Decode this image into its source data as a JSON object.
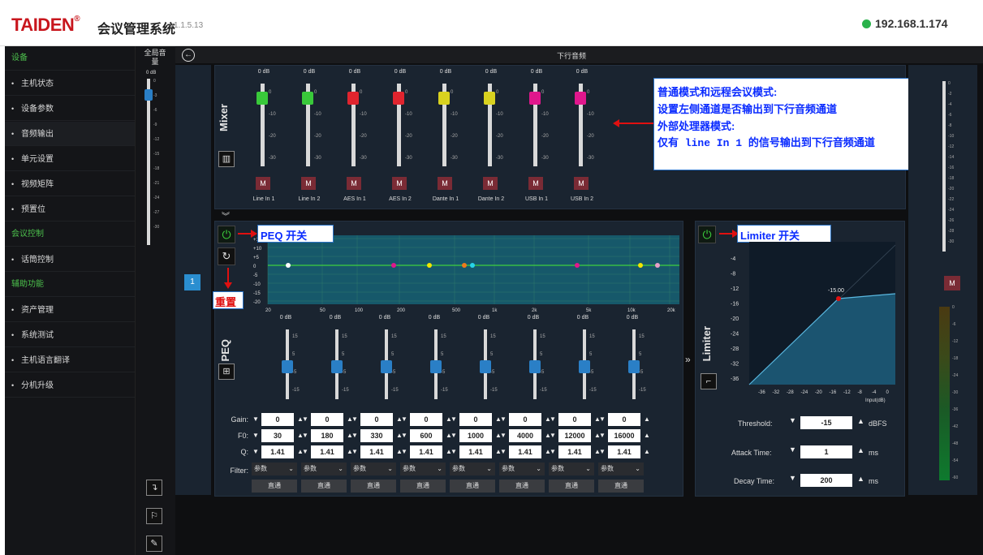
{
  "header": {
    "brand": "TAIDEN",
    "title": "会议管理系统",
    "version": "v1.1.5.13",
    "ip": "192.168.1.174"
  },
  "sidebar": {
    "items": [
      {
        "label": "设备",
        "type": "group"
      },
      {
        "label": "主机状态",
        "icon": "info-icon"
      },
      {
        "label": "设备参数",
        "icon": "gear-icon"
      },
      {
        "label": "音频输出",
        "icon": "sliders-icon",
        "active": true
      },
      {
        "label": "单元设置",
        "icon": "speaker-icon"
      },
      {
        "label": "视频矩阵",
        "icon": "grid-icon"
      },
      {
        "label": "预置位",
        "icon": "camera-icon"
      },
      {
        "label": "会议控制",
        "type": "group"
      },
      {
        "label": "话筒控制",
        "icon": "mic-icon"
      },
      {
        "label": "辅助功能",
        "type": "group"
      },
      {
        "label": "资产管理",
        "icon": "location-icon"
      },
      {
        "label": "系统测试",
        "icon": "test-icon"
      },
      {
        "label": "主机语言翻译",
        "icon": "translate-icon"
      },
      {
        "label": "分机升级",
        "icon": "upload-icon"
      }
    ]
  },
  "master": {
    "label": "全局音量",
    "db": "0 dB",
    "ticks": [
      "0",
      "-3",
      "-6",
      "-9",
      "-12",
      "-15",
      "-18",
      "-21",
      "-24",
      "-27",
      "-30"
    ]
  },
  "panel_title": "下行音频",
  "channel_tab": "1",
  "mixer": {
    "label": "Mixer",
    "scale": [
      "0",
      "-10",
      "-20",
      "-30"
    ],
    "channels": [
      {
        "name": "Line In 1",
        "db": "0 dB",
        "color": "#39c93a"
      },
      {
        "name": "Line In 2",
        "db": "0 dB",
        "color": "#39c93a"
      },
      {
        "name": "AES In 1",
        "db": "0 dB",
        "color": "#e0242e"
      },
      {
        "name": "AES In 2",
        "db": "0 dB",
        "color": "#e0242e"
      },
      {
        "name": "Dante In 1",
        "db": "0 dB",
        "color": "#d9d21f"
      },
      {
        "name": "Dante In 2",
        "db": "0 dB",
        "color": "#d9d21f"
      },
      {
        "name": "USB In 1",
        "db": "0 dB",
        "color": "#e0178c"
      },
      {
        "name": "USB In 2",
        "db": "0 dB",
        "color": "#e0178c"
      }
    ],
    "mute": "M"
  },
  "annotations": {
    "mixer": [
      "普通模式和远程会议模式:",
      "设置左侧通道是否输出到下行音频通道",
      "外部处理器模式:",
      "仅有 line In 1 的信号输出到下行音频通道"
    ],
    "peq_switch": "PEQ 开关",
    "reset": "重置",
    "limiter_switch": "Limiter 开关"
  },
  "peq": {
    "label": "PEQ",
    "graph_y": [
      "+15",
      "+10",
      "+5",
      "0",
      "-5",
      "-10",
      "-15",
      "-20"
    ],
    "graph_x": [
      "20",
      "50",
      "100",
      "200",
      "500",
      "1k",
      "2k",
      "5k",
      "10k",
      "20k"
    ],
    "scale": [
      "15",
      "5",
      "-5",
      "-15"
    ],
    "labels": {
      "gain": "Gain:",
      "f0": "F0:",
      "q": "Q:",
      "filter": "Filter:"
    },
    "bands": [
      {
        "db": "0 dB",
        "gain": "0",
        "f0": "30",
        "q": "1.41",
        "filter": "参数",
        "bypass": "直通",
        "color": "#ffffff"
      },
      {
        "db": "0 dB",
        "gain": "0",
        "f0": "180",
        "q": "1.41",
        "filter": "参数",
        "bypass": "直通",
        "color": "#e0178c"
      },
      {
        "db": "0 dB",
        "gain": "0",
        "f0": "330",
        "q": "1.41",
        "filter": "参数",
        "bypass": "直通",
        "color": "#f2e600"
      },
      {
        "db": "0 dB",
        "gain": "0",
        "f0": "600",
        "q": "1.41",
        "filter": "参数",
        "bypass": "直通",
        "color": "#f07a1a"
      },
      {
        "db": "0 dB",
        "gain": "0",
        "f0": "1000",
        "q": "1.41",
        "filter": "参数",
        "bypass": "直通",
        "color": "#27d4e8"
      },
      {
        "db": "0 dB",
        "gain": "0",
        "f0": "4000",
        "q": "1.41",
        "filter": "参数",
        "bypass": "直通",
        "color": "#e0178c"
      },
      {
        "db": "0 dB",
        "gain": "0",
        "f0": "12000",
        "q": "1.41",
        "filter": "参数",
        "bypass": "直通",
        "color": "#f2e600"
      },
      {
        "db": "0 dB",
        "gain": "0",
        "f0": "16000",
        "q": "1.41",
        "filter": "参数",
        "bypass": "直通",
        "color": "#e8a0c8"
      }
    ]
  },
  "limiter": {
    "label": "Limiter",
    "graph_y": [
      "-4",
      "-8",
      "-12",
      "-16",
      "-20",
      "-24",
      "-28",
      "-32",
      "-36"
    ],
    "graph_x": [
      "-36",
      "-32",
      "-28",
      "-24",
      "-20",
      "-16",
      "-12",
      "-8",
      "-4",
      "0"
    ],
    "x_unit": "Input(dB)",
    "knee_label": "-15.00",
    "threshold": {
      "label": "Threshold:",
      "value": "-15",
      "unit": "dBFS"
    },
    "attack": {
      "label": "Attack Time:",
      "value": "1",
      "unit": "ms"
    },
    "decay": {
      "label": "Decay Time:",
      "value": "200",
      "unit": "ms"
    }
  },
  "right_meter": {
    "ticks": [
      "0",
      "-2",
      "-4",
      "-6",
      "-8",
      "-10",
      "-12",
      "-14",
      "-16",
      "-18",
      "-20",
      "-22",
      "-24",
      "-26",
      "-28",
      "-30"
    ],
    "mute": "M",
    "level_ticks": [
      "0",
      "-6",
      "-12",
      "-18",
      "-24",
      "-30",
      "-36",
      "-42",
      "-48",
      "-54",
      "-60"
    ]
  }
}
